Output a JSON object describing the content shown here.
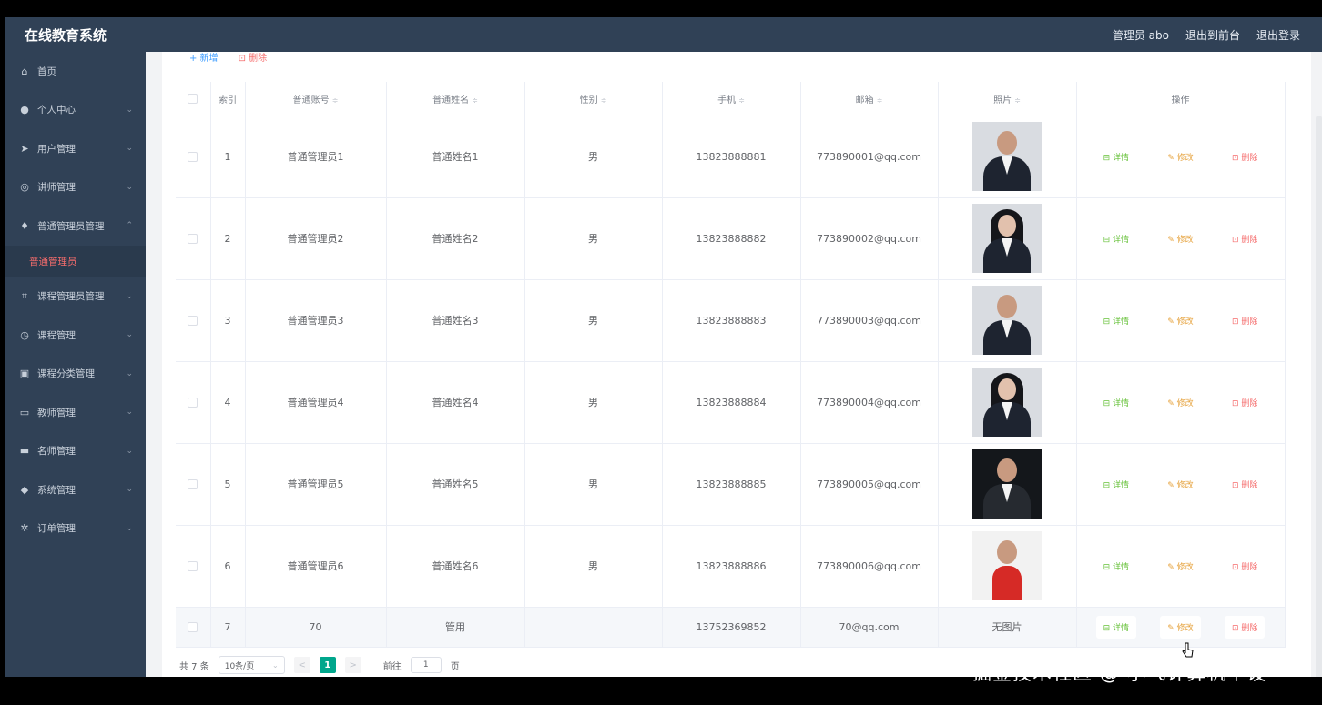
{
  "app": {
    "title": "在线教育系统",
    "user_label": "管理员 abo",
    "to_frontend": "退出到前台",
    "logout": "退出登录"
  },
  "sidebar": {
    "items": [
      {
        "label": "首页",
        "icon": "home-icon",
        "glyph": "⌂"
      },
      {
        "label": "个人中心",
        "icon": "person-icon",
        "glyph": "●",
        "chevron": "⌄"
      },
      {
        "label": "用户管理",
        "icon": "send-icon",
        "glyph": "➤",
        "chevron": "⌄"
      },
      {
        "label": "讲师管理",
        "icon": "compass-icon",
        "glyph": "◎",
        "chevron": "⌄"
      },
      {
        "label": "普通管理员管理",
        "icon": "microphone-icon",
        "glyph": "♦",
        "chevron": "⌃"
      },
      {
        "label": "课程管理员管理",
        "icon": "crop-icon",
        "glyph": "⌗",
        "chevron": "⌄"
      },
      {
        "label": "课程管理",
        "icon": "clock-icon",
        "glyph": "◷",
        "chevron": "⌄"
      },
      {
        "label": "课程分类管理",
        "icon": "clipboard-icon",
        "glyph": "▣",
        "chevron": "⌄"
      },
      {
        "label": "教师管理",
        "icon": "picture-icon",
        "glyph": "▭",
        "chevron": "⌄"
      },
      {
        "label": "名师管理",
        "icon": "chat-icon",
        "glyph": "▬",
        "chevron": "⌄"
      },
      {
        "label": "系统管理",
        "icon": "location-icon",
        "glyph": "◆",
        "chevron": "⌄"
      },
      {
        "label": "订单管理",
        "icon": "settings-icon",
        "glyph": "✲",
        "chevron": "⌄"
      }
    ],
    "active_sub": "普通管理员"
  },
  "toolbar": {
    "add_label": "+ 新增",
    "delete_label": "⊡ 删除"
  },
  "table": {
    "headers": [
      "索引",
      "普通账号",
      "普通姓名",
      "性别",
      "手机",
      "邮箱",
      "照片",
      "操作"
    ],
    "sort_glyph": "≑",
    "rows": [
      {
        "index": "1",
        "account": "普通管理员1",
        "name": "普通姓名1",
        "gender": "男",
        "phone": "13823888881",
        "email": "773890001@qq.com",
        "photo": "male"
      },
      {
        "index": "2",
        "account": "普通管理员2",
        "name": "普通姓名2",
        "gender": "男",
        "phone": "13823888882",
        "email": "773890002@qq.com",
        "photo": "female"
      },
      {
        "index": "3",
        "account": "普通管理员3",
        "name": "普通姓名3",
        "gender": "男",
        "phone": "13823888883",
        "email": "773890003@qq.com",
        "photo": "male"
      },
      {
        "index": "4",
        "account": "普通管理员4",
        "name": "普通姓名4",
        "gender": "男",
        "phone": "13823888884",
        "email": "773890004@qq.com",
        "photo": "female"
      },
      {
        "index": "5",
        "account": "普通管理员5",
        "name": "普通姓名5",
        "gender": "男",
        "phone": "13823888885",
        "email": "773890005@qq.com",
        "photo": "dark"
      },
      {
        "index": "6",
        "account": "普通管理员6",
        "name": "普通姓名6",
        "gender": "男",
        "phone": "13823888886",
        "email": "773890006@qq.com",
        "photo": "red"
      },
      {
        "index": "7",
        "account": "70",
        "name": "管用",
        "gender": "",
        "phone": "13752369852",
        "email": "70@qq.com",
        "photo_text": "无图片"
      }
    ],
    "actions": {
      "detail": "⊟ 详情",
      "edit": "✎ 修改",
      "delete": "⊡ 删除"
    }
  },
  "pagination": {
    "total": "共 7 条",
    "page_size": "10条/页",
    "current_page": "1",
    "goto_label": "前往",
    "goto_value": "1",
    "page_suffix": "页",
    "prev": "<",
    "next": ">"
  },
  "watermark": "掘金技术社区 @ 小飞计算机毕设",
  "colors": {
    "header": "#304156",
    "sidebar": "#304156",
    "accent": "#409eff",
    "active_page": "#00a68c",
    "detail": "#67c23a",
    "edit": "#e6a23c",
    "delete": "#f56c6c"
  }
}
